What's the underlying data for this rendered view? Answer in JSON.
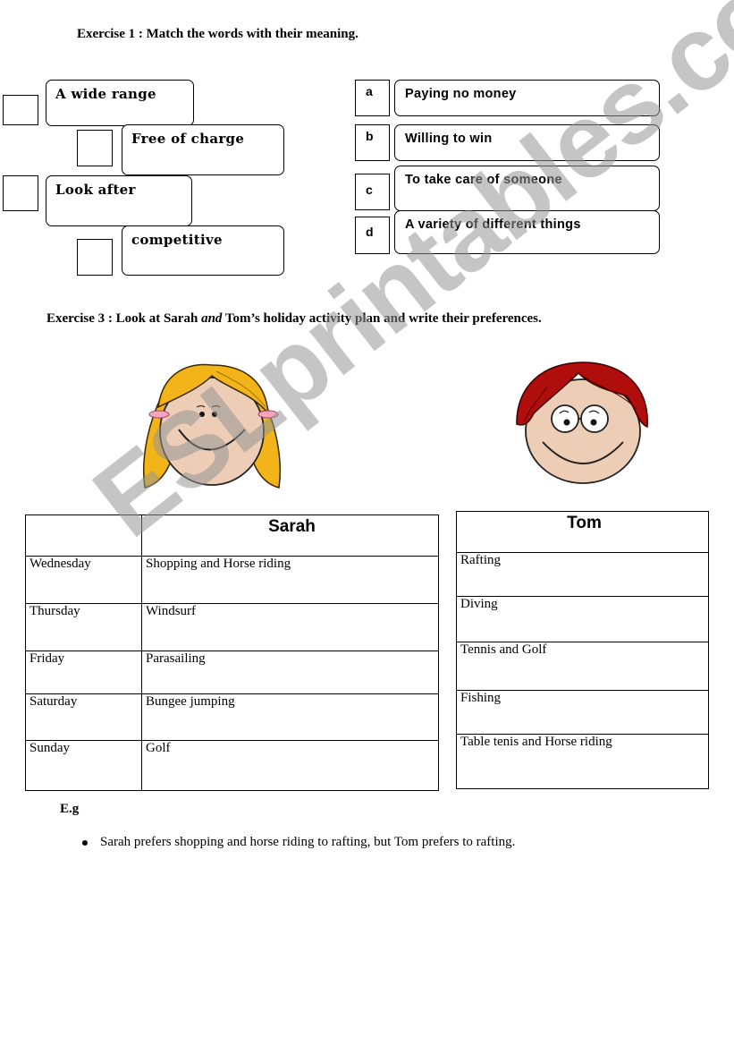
{
  "exercise1": {
    "title": "Exercise 1 : Match the words with their meaning.",
    "words": [
      {
        "text": "A wide range"
      },
      {
        "text": "Free of charge"
      },
      {
        "text": "Look after"
      },
      {
        "text": "competitive"
      }
    ],
    "meanings": [
      {
        "letter": "a",
        "text": "Paying no money"
      },
      {
        "letter": "b",
        "text": "Willing to win"
      },
      {
        "letter": "c",
        "text": "To take care of someone"
      },
      {
        "letter": "d",
        "text": "A variety of different things"
      }
    ]
  },
  "exercise3": {
    "title_part1": "Exercise 3 : Look at Sarah ",
    "title_italic": "and",
    "title_part2": " Tom’s  holiday activity plan and write their preferences.",
    "characters": [
      {
        "name": "Sarah",
        "hair_color": "#f2b418"
      },
      {
        "name": "Tom",
        "hair_color": "#b00d0d"
      }
    ],
    "sarah_table": {
      "header": "Sarah",
      "rows": [
        {
          "day": "Wednesday",
          "activity": "Shopping  and Horse riding"
        },
        {
          "day": "Thursday",
          "activity": "Windsurf"
        },
        {
          "day": "Friday",
          "activity": "Parasailing"
        },
        {
          "day": "Saturday",
          "activity": "Bungee jumping"
        },
        {
          "day": "Sunday",
          "activity": "Golf"
        }
      ]
    },
    "tom_table": {
      "header": "Tom",
      "rows": [
        {
          "activity": "Rafting"
        },
        {
          "activity": "Diving"
        },
        {
          "activity": "Tennis and Golf"
        },
        {
          "activity": "Fishing"
        },
        {
          "activity": "Table tenis and Horse riding"
        }
      ]
    },
    "example_label": "E.g",
    "example_sentence": "Sarah prefers shopping and horse riding to rafting, but Tom prefers to rafting."
  },
  "watermark": "ESLprintables.com"
}
